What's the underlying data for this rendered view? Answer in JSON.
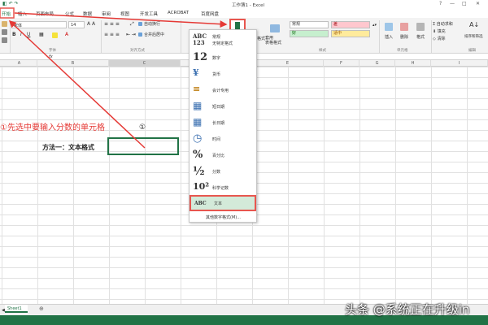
{
  "window": {
    "title": "工作簿1 - Excel",
    "controls": [
      "?",
      "—",
      "□",
      "✕"
    ]
  },
  "tabs": [
    "开始",
    "插入",
    "页面布局",
    "公式",
    "数据",
    "审阅",
    "视图",
    "开发工具",
    "ACROBAT",
    "百度网盘"
  ],
  "ribbon": {
    "font_name": "宋体",
    "font_size": "14",
    "font_group_label": "字体",
    "alignment_group_label": "对齐方式",
    "wrap_text": "自动换行",
    "merge_center": "合并后居中",
    "number_group_label": "",
    "conditional_format": "条件格式",
    "table_format": "套用\n表格格式",
    "styles_group_label": "样式",
    "style_cells": [
      {
        "label": "常规",
        "bg": "#ffffff",
        "fg": "#333333"
      },
      {
        "label": "差",
        "bg": "#ffc7ce",
        "fg": "#9c0006"
      },
      {
        "label": "好",
        "bg": "#c6efce",
        "fg": "#006100"
      },
      {
        "label": "适中",
        "bg": "#ffeb9c",
        "fg": "#9c5700"
      }
    ],
    "insert": "插入",
    "delete": "删除",
    "format": "格式",
    "cells_group_label": "单元格",
    "autosum": "自动求和",
    "fill": "填充",
    "clear": "清除",
    "sort_filter": "排序和筛选",
    "edit_group_label": "编辑"
  },
  "columns": [
    "A",
    "B",
    "C",
    "D",
    "E",
    "F",
    "G",
    "H",
    "I"
  ],
  "format_menu": {
    "items": [
      {
        "icon": "ABC\n123",
        "label": "常规",
        "sublabel": "无特定格式"
      },
      {
        "icon": "12",
        "label": "数字"
      },
      {
        "icon": "¥",
        "label": "货币"
      },
      {
        "icon": "≡",
        "label": "会计专用"
      },
      {
        "icon": "▦",
        "label": "短日期"
      },
      {
        "icon": "▦",
        "label": "长日期"
      },
      {
        "icon": "◷",
        "label": "时间"
      },
      {
        "icon": "%",
        "label": "百分比"
      },
      {
        "icon": "½",
        "label": "分数"
      },
      {
        "icon": "10²",
        "label": "科学记数"
      },
      {
        "icon": "ABC",
        "label": "文本"
      }
    ],
    "more": "其他数字格式(M)..."
  },
  "content": {
    "annotation": "①先选中要输入分数的单元格",
    "circle_num": "①",
    "cell_label": "方法一：文本格式"
  },
  "sheet_tab": "Sheet1",
  "watermark": "头条 @系统正在升级in",
  "colors": {
    "accent": "#217346",
    "annotation_red": "#e53935"
  }
}
